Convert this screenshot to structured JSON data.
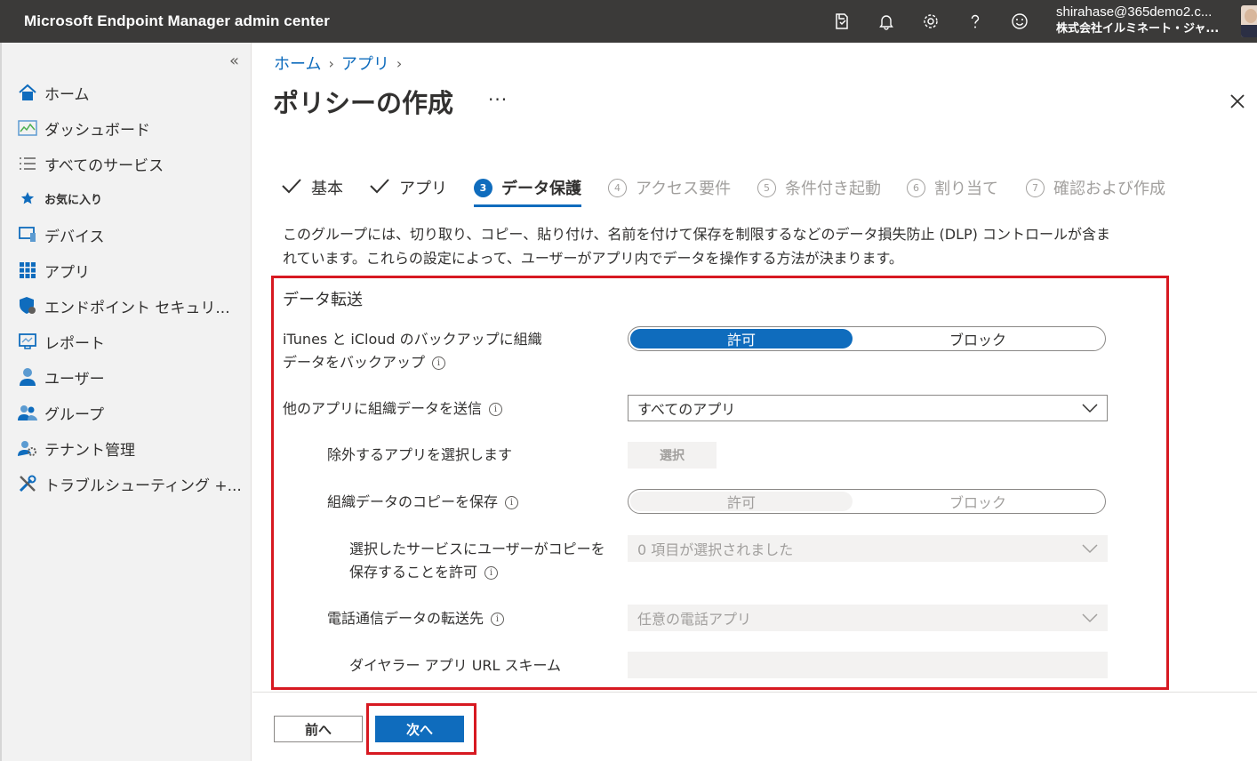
{
  "app": {
    "title": "Microsoft Endpoint Manager admin center",
    "user_email": "shirahase@365demo2.c...",
    "tenant": "株式会社イルミネート・ジャ...",
    "topbar_icons": [
      "feedback-icon",
      "bell-icon",
      "gear-icon",
      "help-icon",
      "smiley-icon"
    ]
  },
  "sidebar": {
    "collapse": "«",
    "items": [
      {
        "label": "ホーム",
        "icon": "home-icon"
      },
      {
        "label": "ダッシュボード",
        "icon": "dashboard-icon"
      },
      {
        "label": "すべてのサービス",
        "icon": "list-icon"
      },
      {
        "label": "お気に入り",
        "icon": "star-icon"
      },
      {
        "label": "デバイス",
        "icon": "device-icon"
      },
      {
        "label": "アプリ",
        "icon": "apps-icon"
      },
      {
        "label": "エンドポイント セキュリ...",
        "icon": "shield-icon"
      },
      {
        "label": "レポート",
        "icon": "report-icon"
      },
      {
        "label": "ユーザー",
        "icon": "user-icon"
      },
      {
        "label": "グループ",
        "icon": "group-icon"
      },
      {
        "label": "テナント管理",
        "icon": "tenant-icon"
      },
      {
        "label": "トラブルシューティング +...",
        "icon": "tools-icon"
      }
    ]
  },
  "breadcrumb": {
    "home": "ホーム",
    "apps": "アプリ"
  },
  "page": {
    "title": "ポリシーの作成",
    "more": "···"
  },
  "steps": [
    {
      "label": "基本",
      "state": "done"
    },
    {
      "label": "アプリ",
      "state": "done"
    },
    {
      "num": "3",
      "label": "データ保護",
      "state": "active"
    },
    {
      "num": "4",
      "label": "アクセス要件",
      "state": "todo"
    },
    {
      "num": "5",
      "label": "条件付き起動",
      "state": "todo"
    },
    {
      "num": "6",
      "label": "割り当て",
      "state": "todo"
    },
    {
      "num": "7",
      "label": "確認および作成",
      "state": "todo"
    }
  ],
  "description": "このグループには、切り取り、コピー、貼り付け、名前を付けて保存を制限するなどのデータ損失防止 (DLP) コントロールが含まれています。これらの設定によって、ユーザーがアプリ内でデータを操作する方法が決まります。",
  "section": {
    "title": "データ転送",
    "backup": {
      "label_line1": "iTunes と iCloud のバックアップに組織",
      "label_line2": "データをバックアップ",
      "allow": "許可",
      "block": "ブロック",
      "selected": "許可"
    },
    "send": {
      "label": "他のアプリに組織データを送信",
      "value": "すべてのアプリ"
    },
    "exclude": {
      "label": "除外するアプリを選択します",
      "button": "選択"
    },
    "save_copies": {
      "label": "組織データのコピーを保存",
      "allow": "許可",
      "block": "ブロック"
    },
    "save_services": {
      "label_line1": "選択したサービスにユーザーがコピーを",
      "label_line2": "保存することを許可",
      "value": "0 項目が選択されました"
    },
    "telecom": {
      "label": "電話通信データの転送先",
      "value": "任意の電話アプリ"
    },
    "dialer": {
      "label": "ダイヤラー アプリ URL スキーム",
      "value": ""
    }
  },
  "footer": {
    "prev": "前へ",
    "next": "次へ"
  },
  "colors": {
    "accent": "#0f6cbd",
    "highlight": "#d71921",
    "topbar": "#3b3a39"
  }
}
